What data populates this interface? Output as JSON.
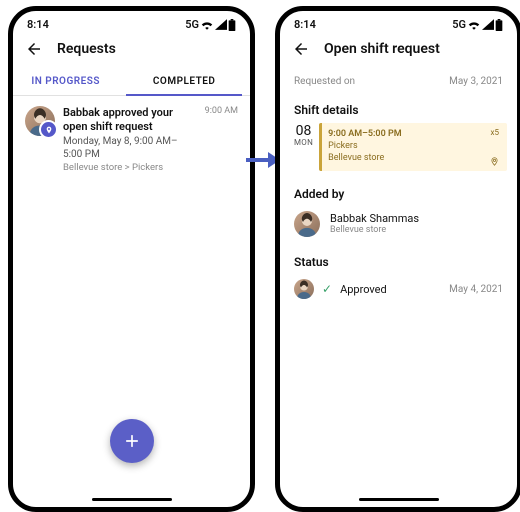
{
  "status": {
    "time": "8:14",
    "net": "5G"
  },
  "left": {
    "title": "Requests",
    "tabs": {
      "in_progress": "IN PROGRESS",
      "completed": "COMPLETED"
    },
    "item": {
      "title": "Babbak approved your open shift request",
      "line2": "Monday, May 8, 9:00 AM–5:00 PM",
      "line3": "Bellevue store > Pickers",
      "time": "9:00 AM"
    }
  },
  "right": {
    "title": "Open shift request",
    "requested_label": "Requested on",
    "requested_date": "May 3, 2021",
    "shift": {
      "header": "Shift details",
      "day": "08",
      "dow": "MON",
      "time": "9:00 AM–5:00 PM",
      "group": "Pickers",
      "store": "Bellevue store",
      "count": "x5"
    },
    "added": {
      "header": "Added by",
      "name": "Babbak Shammas",
      "store": "Bellevue store"
    },
    "status": {
      "header": "Status",
      "value": "Approved",
      "date": "May 4, 2021"
    }
  }
}
